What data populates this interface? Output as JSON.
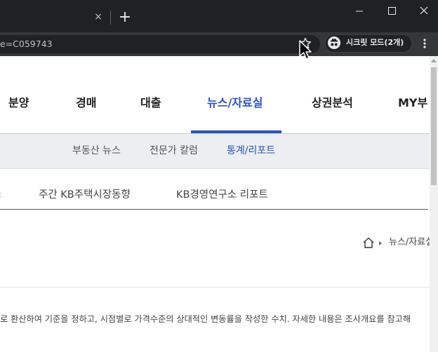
{
  "browser": {
    "tab_close": "×",
    "new_tab": "+",
    "url": "e=C059743",
    "incognito_label": "시크릿 모드(2개)"
  },
  "nav": {
    "items": [
      "분양",
      "경매",
      "대출",
      "뉴스/자료실",
      "상권분석",
      "MY부"
    ],
    "active_index": 3
  },
  "subnav": {
    "items": [
      "부동산 뉴스",
      "전문가 칼럼",
      "통계/리포트"
    ],
    "active_index": 2
  },
  "tabs": {
    "partial": "‹",
    "items": [
      "주간 KB주택시장동향",
      "KB경영연구소 리포트"
    ]
  },
  "breadcrumb": {
    "current": "뉴스/자료실"
  },
  "description": "로 환산하여 기준을 정하고, 시점별로 가격수준의 상대적인 변동률을 작성한 수치. 자세한 내용은 조사개요를 참고해"
}
